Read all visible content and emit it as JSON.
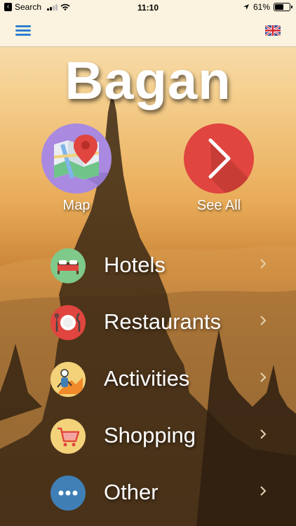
{
  "status_bar": {
    "back_app": "Search",
    "time": "11:10",
    "battery_percent": "61%",
    "battery_level": 0.61
  },
  "nav": {
    "menu_icon": "hamburger-menu-icon",
    "language_icon": "uk-flag-icon"
  },
  "title": "Bagan",
  "quick_actions": [
    {
      "label": "Map",
      "icon": "map-pin-icon",
      "color": "#a98ae0"
    },
    {
      "label": "See All",
      "icon": "chevron-right-icon",
      "color": "#e0453f"
    }
  ],
  "categories": [
    {
      "label": "Hotels",
      "icon": "bed-icon",
      "color": "#7fc98a"
    },
    {
      "label": "Restaurants",
      "icon": "plate-cutlery-icon",
      "color": "#e0453f"
    },
    {
      "label": "Activities",
      "icon": "activities-icon",
      "color": "#f3d27a"
    },
    {
      "label": "Shopping",
      "icon": "shopping-cart-icon",
      "color": "#f3d27a"
    },
    {
      "label": "Other",
      "icon": "more-dots-icon",
      "color": "#3f7fb6"
    }
  ],
  "colors": {
    "accent": "#2f7fd0",
    "nav_background": "#fbf2df"
  }
}
